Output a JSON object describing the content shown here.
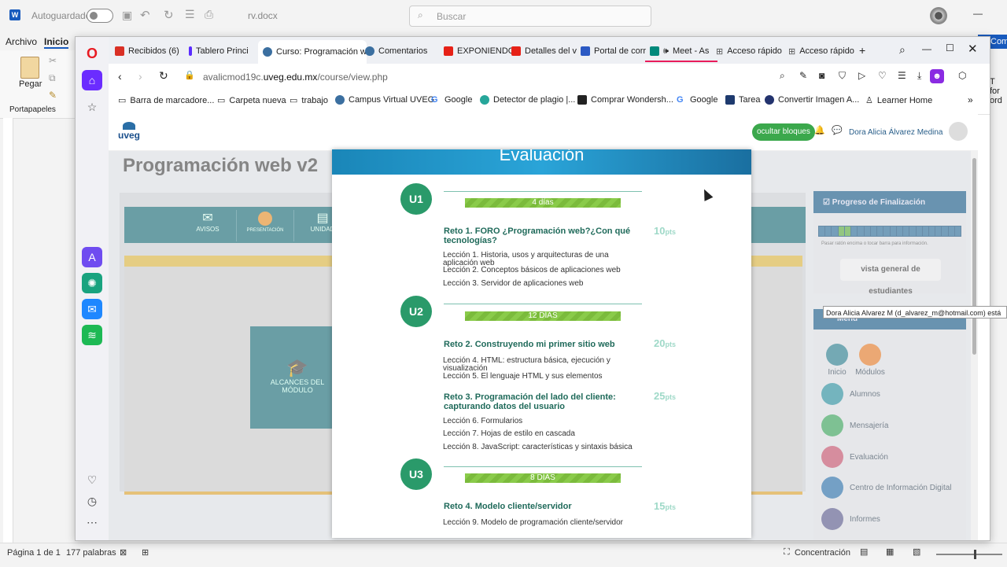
{
  "word": {
    "autosave_label": "Autoguardado",
    "doc_name": "rv.docx",
    "search_placeholder": "Buscar",
    "tabs": [
      "Archivo",
      "Inicio"
    ],
    "paste_label": "Pegar",
    "clipboard_group": "Portapapeles",
    "status_page": "Página 1 de 1",
    "status_words": "177 palabras",
    "status_focus": "Concentración",
    "right_ribbon_text_1": "T for",
    "right_ribbon_text_2": "ord",
    "com_label": "Com"
  },
  "browser": {
    "tabs": [
      {
        "label": "Recibidos (6)",
        "color": "#d93025"
      },
      {
        "label": "Tablero Princi",
        "color": "#2b59c3"
      },
      {
        "label": "Curso: Programación w",
        "color": "#3b6fa0"
      },
      {
        "label": "Comentarios",
        "color": "#3b6fa0"
      },
      {
        "label": "EXPONIENDO",
        "color": "#e62117"
      },
      {
        "label": "Detalles del v",
        "color": "#e62117"
      },
      {
        "label": "Portal de corr",
        "color": "#2b59c3"
      },
      {
        "label": "Meet - As",
        "color": "#00897b"
      },
      {
        "label": "Acceso rápido",
        "color": "#555555"
      },
      {
        "label": "Acceso rápido",
        "color": "#555555"
      }
    ],
    "url_prefix": "avalicmod19c.",
    "url_domain": "uveg.edu.mx",
    "url_path": "/course/view.php",
    "bookmarks": [
      "Barra de marcadore...",
      "Carpeta nueva",
      "trabajo",
      "Campus Virtual UVEG",
      "Google",
      "Detector de plagio |...",
      "Comprar Wondersh...",
      "Google",
      "Tarea",
      "Convertir Imagen A...",
      "Learner Home"
    ]
  },
  "moodle": {
    "logo": "uveg",
    "hide_blocks": "ocultar bloques",
    "user_name": "Dora Alicia Álvarez Medina",
    "course_title": "Programación web v2",
    "nav_items": [
      "AVISOS",
      "PRESENTACIÓN",
      "UNIDAD"
    ],
    "alcances": "ALCANCES DEL MÓDULO",
    "progress_title": "Progreso de Finalización",
    "progress_hint": "Pasar ratón encima o tocar barra para información.",
    "overview_button": "vista general de estudiantes",
    "menu_title": "Menú",
    "menu_items": [
      "Inicio",
      "Módulos",
      "Alumnos",
      "Mensajería",
      "Evaluación",
      "Centro de Información Digital",
      "Informes"
    ],
    "tooltip": "Dora Alicia Alvarez M (d_alvarez_m@hotmail.com) está"
  },
  "evaluation": {
    "title": "Evaluación",
    "units": [
      {
        "badge": "U1",
        "days": "4 días"
      },
      {
        "badge": "U2",
        "days": "12 DÍAS"
      },
      {
        "badge": "U3",
        "days": "8 DÍAS"
      }
    ],
    "retos": [
      {
        "title": "Reto 1. FORO ¿Programación web?¿Con qué tecnologías?",
        "pts": "10",
        "unit": "pts"
      },
      {
        "title": "Reto 2. Construyendo mi primer sitio web",
        "pts": "20",
        "unit": "pts"
      },
      {
        "title": "Reto 3. Programación del lado del cliente: capturando datos del usuario",
        "pts": "25",
        "unit": "pts"
      },
      {
        "title": "Reto 4. Modelo cliente/servidor",
        "pts": "15",
        "unit": "pts"
      }
    ],
    "lecciones": [
      "Lección 1. Historia, usos y arquitecturas de una aplicación web",
      "Lección 2. Conceptos básicos de aplicaciones web",
      "Lección 3. Servidor de aplicaciones web",
      "Lección 4. HTML: estructura básica, ejecución y visualización",
      "Lección 5. El lenguaje HTML y sus elementos",
      "Lección 6. Formularios",
      "Lección 7. Hojas de estilo en cascada",
      "Lección 8. JavaScript: características y sintaxis básica",
      "Lección 9. Modelo de programación cliente/servidor"
    ]
  }
}
